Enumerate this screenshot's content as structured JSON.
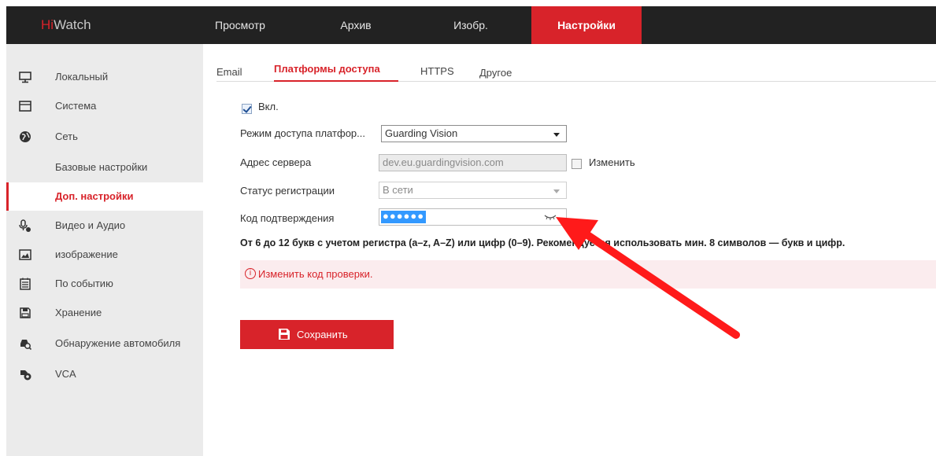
{
  "app": {
    "logo_prefix": "Hi",
    "logo_suffix": "Watch"
  },
  "topnav": [
    {
      "label": "Просмотр"
    },
    {
      "label": "Архив"
    },
    {
      "label": "Изобр."
    },
    {
      "label": "Настройки",
      "active": true
    }
  ],
  "sidebar": [
    {
      "label": "Локальный",
      "icon": "monitor-icon"
    },
    {
      "label": "Система",
      "icon": "system-icon"
    },
    {
      "label": "Сеть",
      "icon": "globe-icon"
    },
    {
      "label": "Базовые настройки"
    },
    {
      "label": "Доп. настройки",
      "active": true
    },
    {
      "label": "Видео и Аудио",
      "icon": "video-audio-icon"
    },
    {
      "label": "изображение",
      "icon": "image-icon"
    },
    {
      "label": "По событию",
      "icon": "calendar-icon"
    },
    {
      "label": "Хранение",
      "icon": "storage-icon"
    },
    {
      "label": "Обнаружение автомобиля",
      "icon": "vehicle-search-icon"
    },
    {
      "label": "VCA",
      "icon": "vca-icon"
    }
  ],
  "tabs": [
    {
      "label": "Email"
    },
    {
      "label": "Платформы доступа",
      "active": true
    },
    {
      "label": "HTTPS"
    },
    {
      "label": "Другое"
    }
  ],
  "form": {
    "enable_label": "Вкл.",
    "enable_checked": true,
    "mode_label": "Режим доступа платфор...",
    "mode_value": "Guarding Vision",
    "server_label": "Адрес сервера",
    "server_value": "dev.eu.guardingvision.com",
    "change_label": "Изменить",
    "status_label": "Статус регистрации",
    "status_value": "В сети",
    "code_label": "Код подтверждения",
    "code_value": "●●●●●●",
    "hint": "От 6 до 12 букв с учетом регистра (a–z, A–Z) или цифр (0–9). Рекомендуется использовать мин. 8 символов — букв и цифр.",
    "alert": "Изменить код проверки.",
    "save_label": "Сохранить"
  },
  "colors": {
    "accent": "#d8232a",
    "topbar": "#222222",
    "sidebar": "#ebebeb",
    "alert_bg": "#fbecee",
    "arrow": "#ff1a1a"
  }
}
